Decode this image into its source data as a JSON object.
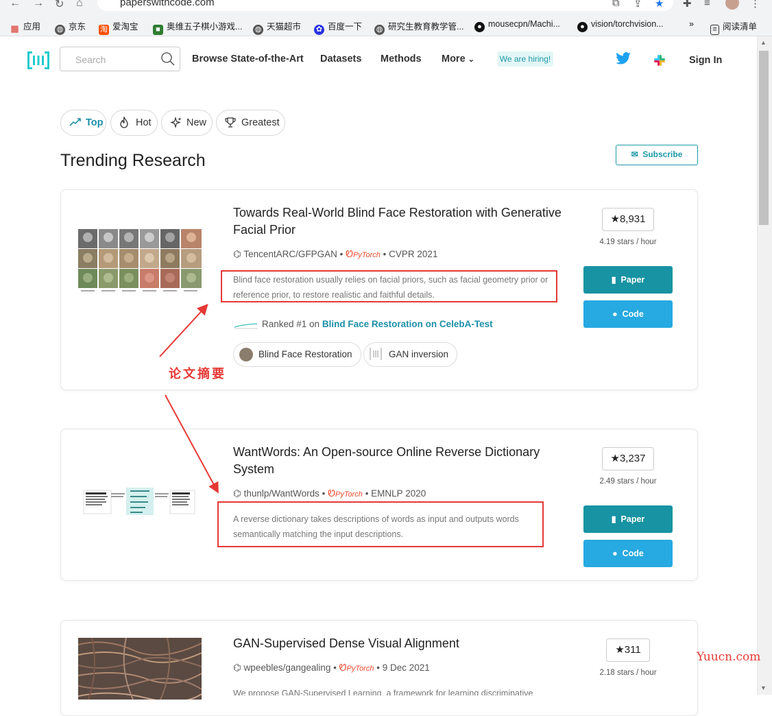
{
  "browser": {
    "url": "paperswithcode.com",
    "bookmarks": [
      "应用",
      "京东",
      "爱淘宝",
      "奥维五子棋小游戏...",
      "天猫超市",
      "百度一下",
      "研究生教育教学管...",
      "mousecpn/Machi...",
      "vision/torchvision...",
      "阅读清单"
    ],
    "more_label": "»"
  },
  "header": {
    "search_placeholder": "Search",
    "nav": [
      "Browse State-of-the-Art",
      "Datasets",
      "Methods",
      "More"
    ],
    "hiring": "We are hiring!",
    "signin": "Sign In"
  },
  "filters": [
    "Top",
    "Hot",
    "New",
    "Greatest"
  ],
  "page_title": "Trending Research",
  "subscribe": "Subscribe",
  "papers": [
    {
      "title": "Towards Real-World Blind Face Restoration with Generative Facial Prior",
      "repo": "TencentARC/GFPGAN",
      "framework": "PyTorch",
      "venue": "CVPR 2021",
      "abstract": "Blind face restoration usually relies on facial priors, such as facial geometry prior or reference prior, to restore realistic and faithful details.",
      "ranked_prefix": "Ranked #1 on",
      "ranked_task": "Blind Face Restoration on CelebA-Test",
      "tags": [
        "Blind Face Restoration",
        "GAN inversion"
      ],
      "stars": "8,931",
      "rate": "4.19 stars / hour",
      "paper_btn": "Paper",
      "code_btn": "Code"
    },
    {
      "title": "WantWords: An Open-source Online Reverse Dictionary System",
      "repo": "thunlp/WantWords",
      "framework": "PyTorch",
      "venue": "EMNLP 2020",
      "abstract": "A reverse dictionary takes descriptions of words as input and outputs words semantically matching the input descriptions.",
      "stars": "3,237",
      "rate": "2.49 stars / hour",
      "paper_btn": "Paper",
      "code_btn": "Code"
    },
    {
      "title": "GAN-Supervised Dense Visual Alignment",
      "repo": "wpeebles/gangealing",
      "framework": "PyTorch",
      "venue": "9 Dec 2021",
      "abstract": "We propose GAN-Supervised Learning, a framework for learning discriminative",
      "stars": "311",
      "rate": "2.18 stars / hour"
    }
  ],
  "annotation": "论文摘要",
  "watermark": "Yuucn.com",
  "colors": {
    "teal": "#1793a3",
    "code_blue": "#27a9e1",
    "annotation_red": "#e53935"
  }
}
